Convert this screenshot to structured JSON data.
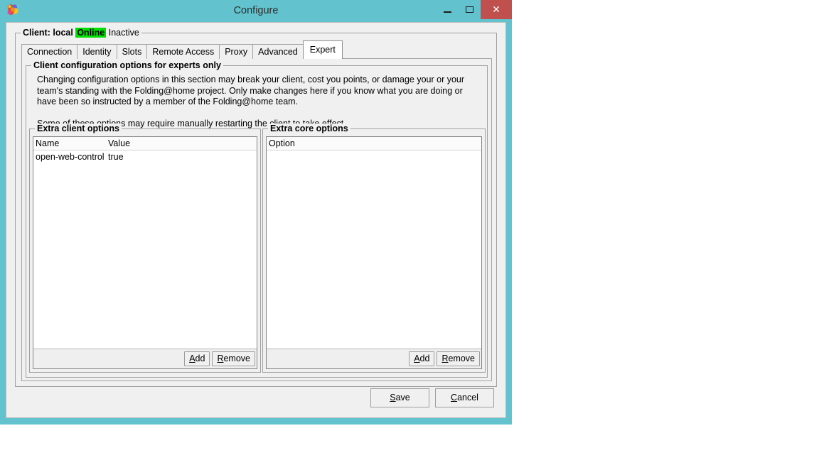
{
  "window": {
    "title": "Configure",
    "icon": "folding-at-home-logo-icon",
    "controls": {
      "minimize_label": "–",
      "maximize_label": "☐",
      "close_label": "✕"
    },
    "colors": {
      "titlebar": "#62c2cd",
      "close_button": "#c0504d",
      "client_area": "#f0f0f0",
      "online_badge": "#00e000"
    }
  },
  "client_group": {
    "prefix": "Client: local",
    "status_online": "Online",
    "status_activity": "Inactive"
  },
  "tabs": [
    {
      "label": "Connection",
      "selected": false
    },
    {
      "label": "Identity",
      "selected": false
    },
    {
      "label": "Slots",
      "selected": false
    },
    {
      "label": "Remote Access",
      "selected": false
    },
    {
      "label": "Proxy",
      "selected": false
    },
    {
      "label": "Advanced",
      "selected": false
    },
    {
      "label": "Expert",
      "selected": true
    }
  ],
  "expert": {
    "group_title": "Client configuration options for experts only",
    "paragraph_1": "Changing configuration options in this section may break your client, cost you points, or damage your or your team's standing with the Folding@home project.  Only make changes here if you know what you are doing or have been so instructed by a member of the Folding@home team.",
    "paragraph_2": "Some of these options may require manually restarting the client to take effect."
  },
  "client_options": {
    "group_title": "Extra client options",
    "columns": [
      "Name",
      "Value"
    ],
    "rows": [
      {
        "name": "open-web-control",
        "value": "true"
      }
    ],
    "add_label": "Add",
    "add_mnemonic": "A",
    "add_rest": "dd",
    "remove_label": "Remove",
    "remove_mnemonic": "R",
    "remove_rest": "emove"
  },
  "core_options": {
    "group_title": "Extra core options",
    "columns": [
      "Option"
    ],
    "rows": [],
    "add_mnemonic": "A",
    "add_rest": "dd",
    "remove_mnemonic": "R",
    "remove_rest": "emove"
  },
  "dialog_actions": {
    "save_mnemonic": "S",
    "save_rest": "ave",
    "cancel_mnemonic": "C",
    "cancel_rest": "ancel"
  }
}
